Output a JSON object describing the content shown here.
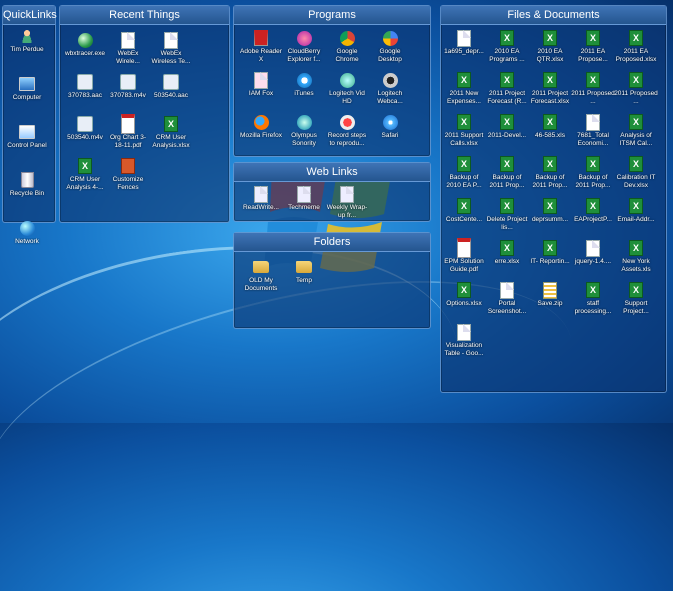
{
  "fences": {
    "quicklinks": {
      "title": "QuickLinks",
      "items": [
        {
          "label": "Tim Perdue",
          "icon": "user-folder-icon"
        },
        {
          "label": "Computer",
          "icon": "computer-icon"
        },
        {
          "label": "Control Panel",
          "icon": "control-panel-icon"
        },
        {
          "label": "Recycle Bin",
          "icon": "recycle-bin-icon"
        },
        {
          "label": "Network",
          "icon": "network-icon"
        }
      ]
    },
    "recent": {
      "title": "Recent Things",
      "items": [
        {
          "label": "wbxtracer.exe",
          "icon": "globe-icon"
        },
        {
          "label": "WebEx Wirele...",
          "icon": "document-icon"
        },
        {
          "label": "WebEx Wireless Te...",
          "icon": "document-icon"
        },
        {
          "label": "370783.aac",
          "icon": "media-icon"
        },
        {
          "label": "370783.m4v",
          "icon": "media-icon"
        },
        {
          "label": "503540.aac",
          "icon": "media-icon"
        },
        {
          "label": "503540.m4v",
          "icon": "media-icon"
        },
        {
          "label": "Org Chart 3-18-11.pdf",
          "icon": "pdf-icon"
        },
        {
          "label": "CRM User Analysis.xlsx",
          "icon": "excel-icon"
        },
        {
          "label": "CRM User Analysis 4-...",
          "icon": "excel-icon"
        },
        {
          "label": "Customize Fences",
          "icon": "fences-icon"
        }
      ]
    },
    "programs": {
      "title": "Programs",
      "items": [
        {
          "label": "Adobe Reader X",
          "icon": "adobe-reader-icon"
        },
        {
          "label": "CloudBerry Explorer f...",
          "icon": "cloudberry-icon"
        },
        {
          "label": "Google Chrome",
          "icon": "chrome-icon"
        },
        {
          "label": "Google Desktop",
          "icon": "google-desktop-icon"
        },
        {
          "label": "IAM Fox",
          "icon": "iam-fox-icon"
        },
        {
          "label": "iTunes",
          "icon": "itunes-icon"
        },
        {
          "label": "Logitech Vid HD",
          "icon": "logitech-vid-icon"
        },
        {
          "label": "Logitech Webca...",
          "icon": "webcam-icon"
        },
        {
          "label": "Mozilla Firefox",
          "icon": "firefox-icon"
        },
        {
          "label": "Olympus Sonority",
          "icon": "olympus-icon"
        },
        {
          "label": "Record steps to reprodu...",
          "icon": "steps-recorder-icon"
        },
        {
          "label": "Safari",
          "icon": "safari-icon"
        }
      ]
    },
    "weblinks": {
      "title": "Web Links",
      "items": [
        {
          "label": "ReadWrite...",
          "icon": "web-link-icon"
        },
        {
          "label": "Techmeme",
          "icon": "web-link-icon"
        },
        {
          "label": "Weekly Wrap-up fr...",
          "icon": "web-link-icon"
        }
      ]
    },
    "folders": {
      "title": "Folders",
      "items": [
        {
          "label": "OLD My Documents",
          "icon": "folder-icon"
        },
        {
          "label": "Temp",
          "icon": "folder-icon"
        }
      ]
    },
    "files": {
      "title": "Files & Documents",
      "items": [
        {
          "label": "1a695_depr...",
          "icon": "document-icon"
        },
        {
          "label": "2010 EA Programs ...",
          "icon": "excel-icon"
        },
        {
          "label": "2010 EA QTR.xlsx",
          "icon": "excel-icon"
        },
        {
          "label": "2011 EA Propose...",
          "icon": "excel-icon"
        },
        {
          "label": "2011 EA Proposed.xlsx",
          "icon": "excel-icon"
        },
        {
          "label": "2011 New Expenses...",
          "icon": "excel-icon"
        },
        {
          "label": "2011 Project Forecast (R...",
          "icon": "excel-icon"
        },
        {
          "label": "2011 Project Forecast.xlsx",
          "icon": "excel-icon"
        },
        {
          "label": "2011 Proposed ...",
          "icon": "excel-icon"
        },
        {
          "label": "2011 Proposed ...",
          "icon": "excel-icon"
        },
        {
          "label": "2011 Support Calls.xlsx",
          "icon": "excel-icon"
        },
        {
          "label": "2011-Devel...",
          "icon": "excel-icon"
        },
        {
          "label": "46-585.xls",
          "icon": "excel-icon"
        },
        {
          "label": "7681_Total Economi...",
          "icon": "document-icon"
        },
        {
          "label": "Analysis of ITSM Cal...",
          "icon": "excel-icon"
        },
        {
          "label": "Backup of 2010 EA P...",
          "icon": "excel-icon"
        },
        {
          "label": "Backup of 2011 Prop...",
          "icon": "excel-icon"
        },
        {
          "label": "Backup of 2011 Prop...",
          "icon": "excel-icon"
        },
        {
          "label": "Backup of 2011 Prop...",
          "icon": "excel-icon"
        },
        {
          "label": "Calibration IT Dev.xlsx",
          "icon": "excel-icon"
        },
        {
          "label": "CostCente...",
          "icon": "excel-icon"
        },
        {
          "label": "Delete Project lis...",
          "icon": "excel-icon"
        },
        {
          "label": "deprsumm...",
          "icon": "excel-icon"
        },
        {
          "label": "EAProjectP...",
          "icon": "excel-icon"
        },
        {
          "label": "Email-Addr...",
          "icon": "excel-icon"
        },
        {
          "label": "EPM Solution Guide.pdf",
          "icon": "pdf-icon"
        },
        {
          "label": "erre.xlsx",
          "icon": "excel-icon"
        },
        {
          "label": "IT- Reportin...",
          "icon": "excel-icon"
        },
        {
          "label": "jquery-1.4....",
          "icon": "document-icon"
        },
        {
          "label": "New York Assets.xls",
          "icon": "excel-icon"
        },
        {
          "label": "Options.xlsx",
          "icon": "excel-icon"
        },
        {
          "label": "Portal Screenshot...",
          "icon": "document-icon"
        },
        {
          "label": "Save.zip",
          "icon": "zip-icon"
        },
        {
          "label": "staff processing...",
          "icon": "excel-icon"
        },
        {
          "label": "Support Project...",
          "icon": "excel-icon"
        },
        {
          "label": "Visualization Table - Goo...",
          "icon": "document-icon"
        }
      ]
    }
  }
}
